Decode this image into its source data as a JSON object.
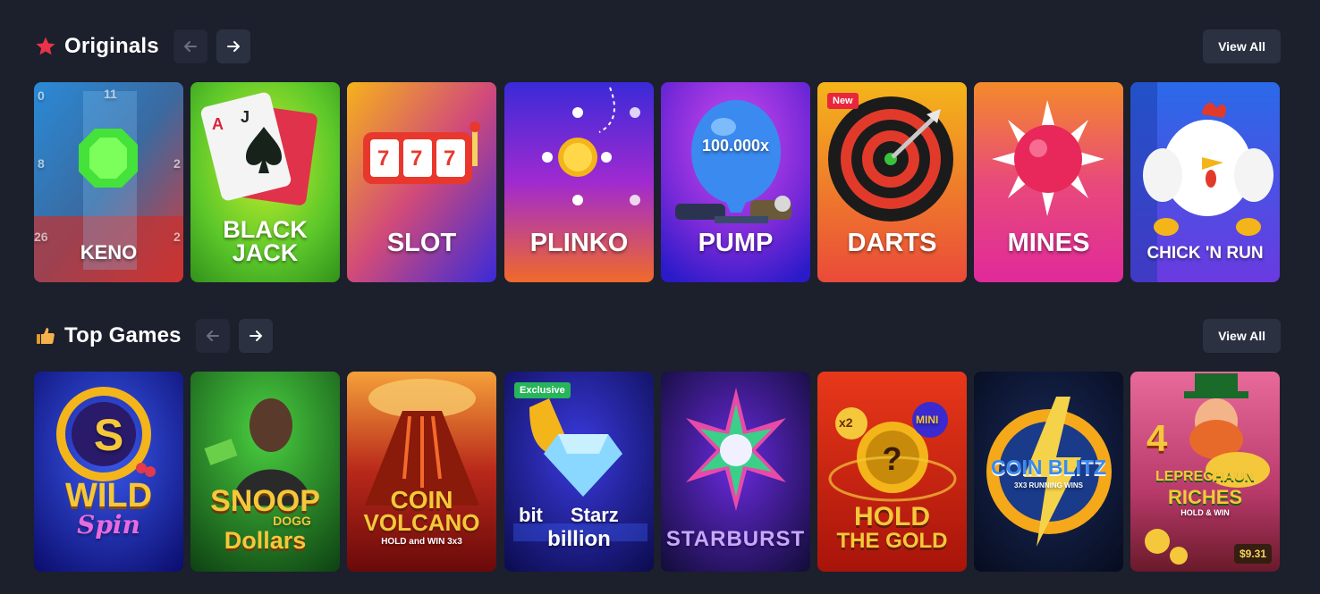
{
  "originals": {
    "title": "Originals",
    "icon": "star-icon",
    "view_all": "View All",
    "cards": [
      {
        "label": "KENO"
      },
      {
        "label1": "BLACK",
        "label2": "JACK"
      },
      {
        "label": "SLOT"
      },
      {
        "label": "PLINKO"
      },
      {
        "label": "PUMP",
        "multiplier": "100.000x"
      },
      {
        "label": "DARTS",
        "badge": "New"
      },
      {
        "label": "MINES"
      },
      {
        "label": "CHICK 'N RUN"
      }
    ],
    "keno_numbers": {
      "n0": "0",
      "n11": "11",
      "n8": "8",
      "n2a": "2",
      "n26": "26",
      "n2b": "2"
    },
    "blackjack_cards": {
      "a": "A",
      "j": "J"
    },
    "slot_reels": [
      "7",
      "7",
      "7"
    ]
  },
  "top_games": {
    "title": "Top Games",
    "icon": "thumbs-up-icon",
    "view_all": "View All",
    "cards": [
      {
        "title1": "WILD",
        "title2": "Spin",
        "logo": "S"
      },
      {
        "title1": "SNOOP",
        "title2": "DOGG",
        "title3": "Dollars"
      },
      {
        "title1": "COIN",
        "title2": "VOLCANO",
        "sub": "HOLD and WIN 3x3"
      },
      {
        "title1": "bit",
        "title2": "Starz",
        "title3": "billion",
        "badge": "Exclusive"
      },
      {
        "title1": "STARBURST"
      },
      {
        "title1": "HOLD",
        "title2": "THE GOLD",
        "tag1": "x2",
        "tag2": "MINI"
      },
      {
        "title1": "COIN BLITZ",
        "sub": "3X3 RUNNING WINS"
      },
      {
        "number": "4",
        "title1": "LEPRECHAUN",
        "title2": "RICHES",
        "sub": "HOLD & WIN",
        "price": "$9.31"
      }
    ]
  },
  "colors": {
    "background": "#1c1f2c",
    "button": "#2c3142",
    "badge_new": "#e8263c",
    "badge_exclusive": "#27b45a"
  }
}
